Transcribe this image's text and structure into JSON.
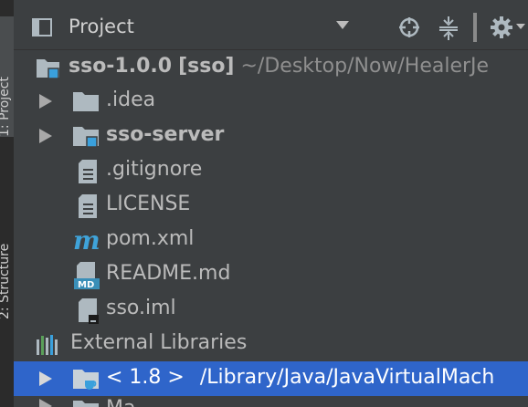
{
  "side_tabs": {
    "project": "1: Project",
    "structure": "2: Structure"
  },
  "header": {
    "title": "Project"
  },
  "tree": {
    "root": {
      "name": "sso-1.0.0",
      "module": "[sso]",
      "path": "~/Desktop/Now/HealerJe"
    },
    "children": [
      {
        "label": ".idea"
      },
      {
        "label": "sso-server"
      },
      {
        "label": ".gitignore"
      },
      {
        "label": "LICENSE"
      },
      {
        "label": "pom.xml"
      },
      {
        "label": "README.md"
      },
      {
        "label": "sso.iml"
      }
    ],
    "external_libraries": {
      "label": "External Libraries",
      "jdk": {
        "name": "< 1.8 >",
        "path": "/Library/Java/JavaVirtualMach"
      },
      "next_partial": "Ma"
    }
  },
  "colors": {
    "background": "#3c3f41",
    "selection": "#2f65ca",
    "module_marker": "#3aa0dc"
  }
}
